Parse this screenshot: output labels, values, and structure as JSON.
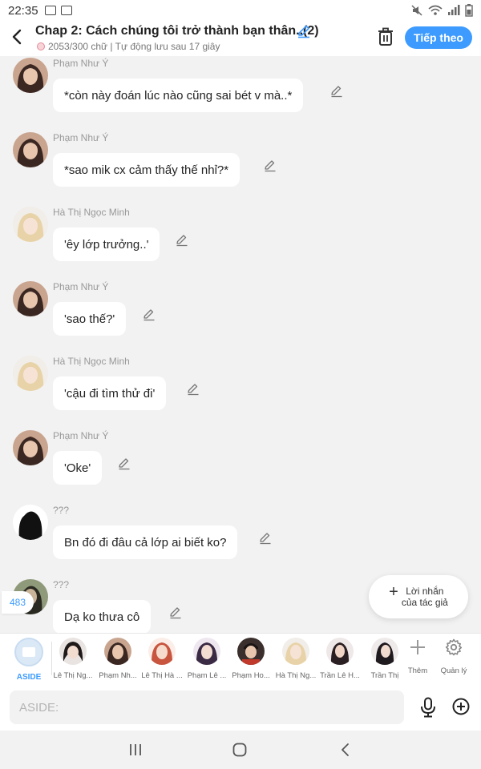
{
  "status_bar": {
    "time": "22:35"
  },
  "header": {
    "title": "Chap 2: Cách chúng tôi trở thành bạn thân..(2)",
    "subtitle": "2053/300 chữ | Tự động lưu sau 17 giây",
    "next_label": "Tiếp theo"
  },
  "colors": {
    "accent": "#3d9bff",
    "background": "#f2f2f2",
    "bubble": "#ffffff"
  },
  "messages": [
    {
      "sender": "Phạm Như Ý",
      "text": "*còn này đoán lúc nào cũng sai bét v mà..*",
      "avatar": "dark-hair-girl"
    },
    {
      "sender": "Phạm Như Ý",
      "text": "*sao mik cx cảm thấy thế nhỉ?*",
      "avatar": "dark-hair-girl"
    },
    {
      "sender": "Hà Thị Ngọc Minh",
      "text": "'êy lớp trưởng..'",
      "avatar": "blonde-girl"
    },
    {
      "sender": "Phạm Như Ý",
      "text": "'sao thế?'",
      "avatar": "dark-hair-girl"
    },
    {
      "sender": "Hà Thị Ngọc Minh",
      "text": "'cậu đi tìm thử đi'",
      "avatar": "blonde-girl"
    },
    {
      "sender": "Phạm Như Ý",
      "text": "'Oke'",
      "avatar": "dark-hair-girl"
    },
    {
      "sender": "???",
      "text": "Bn đó đi đâu cả lớp ai biết ko?",
      "avatar": "silhouette"
    },
    {
      "sender": "???",
      "text": "Dạ ko thưa cô",
      "avatar": "silhouette-green"
    }
  ],
  "counter": "483",
  "author_note": {
    "line1": "Lời nhắn",
    "line2": "của tác giả"
  },
  "character_bar": {
    "aside_label": "ASIDE",
    "characters": [
      {
        "name": "Lê Thị Ng...",
        "avatar": "short-dark-hair"
      },
      {
        "name": "Phạm Nh...",
        "avatar": "dark-hair-girl"
      },
      {
        "name": "Lê Thị Hà ...",
        "avatar": "red-hair"
      },
      {
        "name": "Phạm Lê ...",
        "avatar": "purple-hair"
      },
      {
        "name": "Phạm Ho...",
        "avatar": "boy-red-shirt"
      },
      {
        "name": "Hà Thị Ng...",
        "avatar": "blonde-girl"
      },
      {
        "name": "Trần Lê H...",
        "avatar": "long-dark-hair"
      },
      {
        "name": "Trần Thị",
        "avatar": "black-hair"
      }
    ],
    "add_label": "Thêm",
    "manage_label": "Quản lý"
  },
  "input": {
    "placeholder": "ASIDE:"
  },
  "icons": {
    "back": "chevron-left-icon",
    "title_edit": "pencil-icon",
    "trash": "trash-icon",
    "edit": "pencil-icon",
    "mic": "microphone-icon",
    "plus": "plus-circle-icon",
    "gear": "gear-icon"
  }
}
